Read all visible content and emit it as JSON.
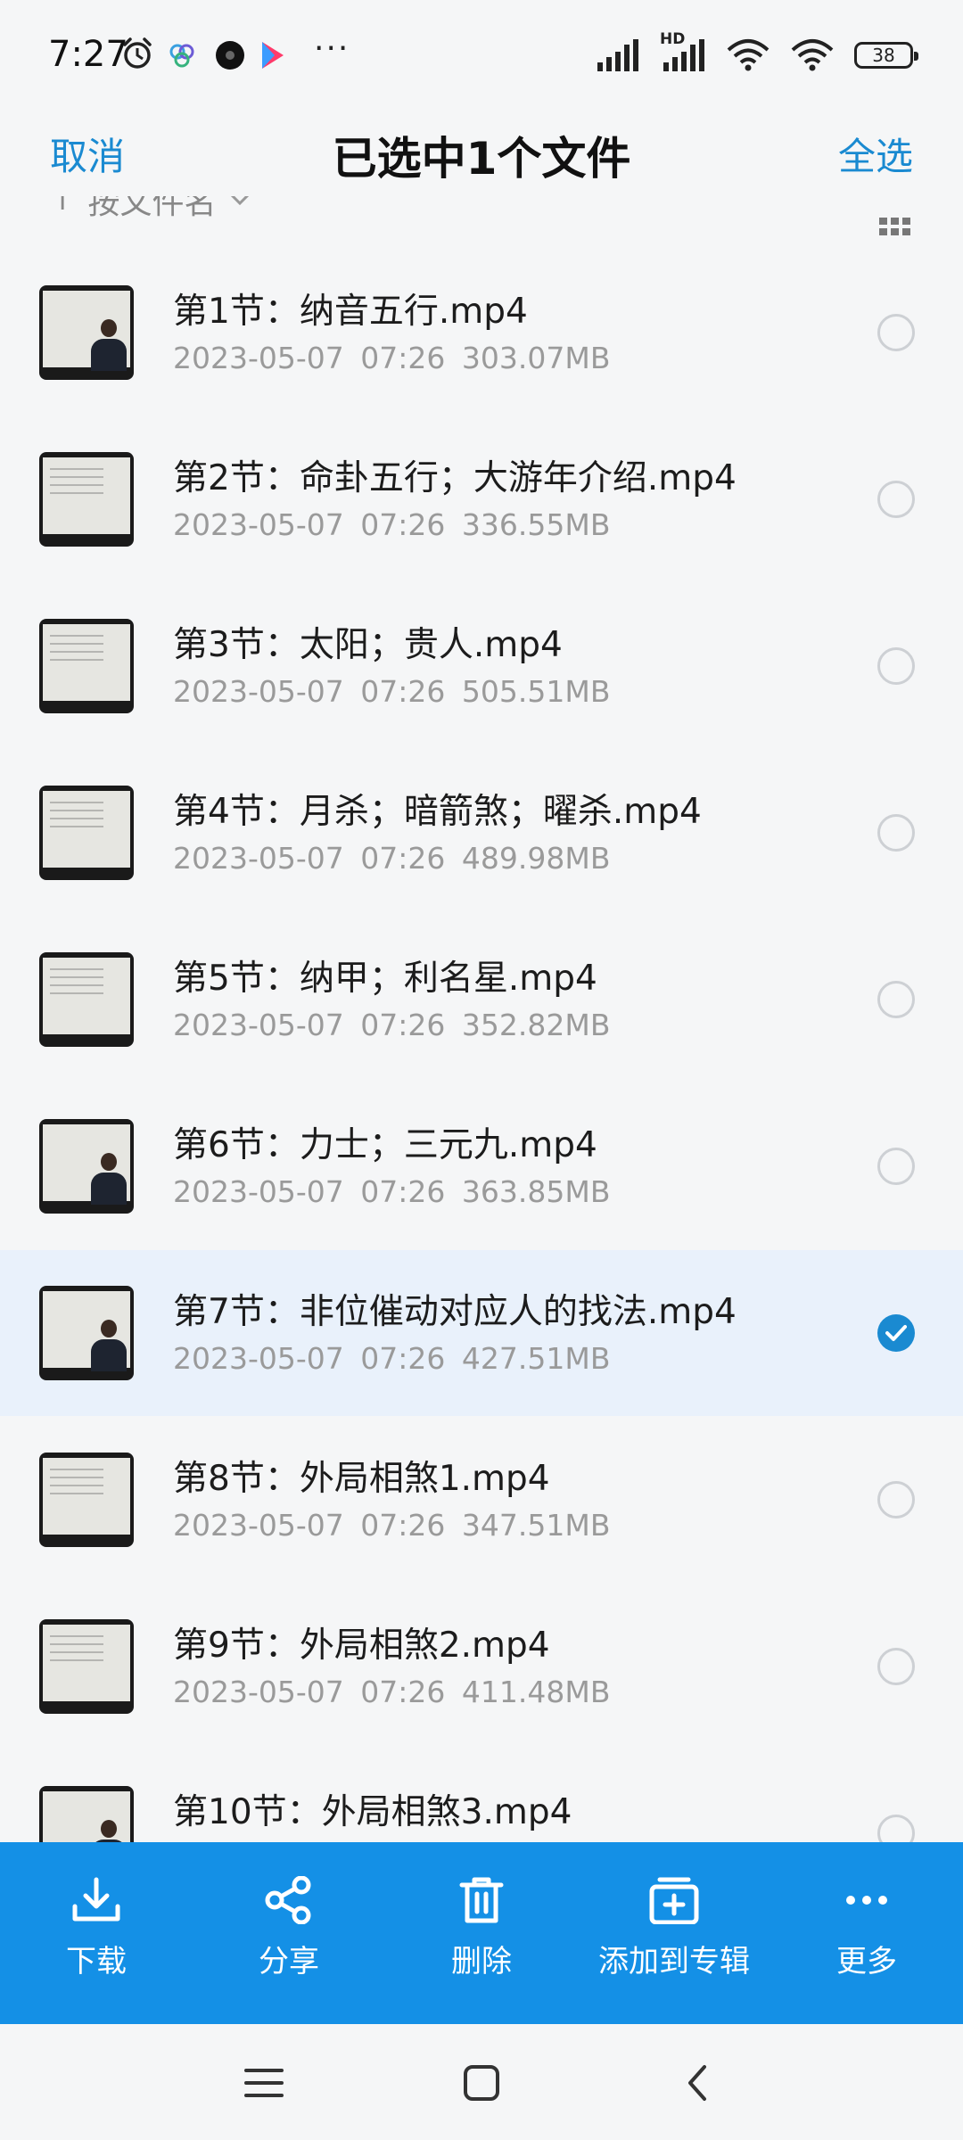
{
  "status_bar": {
    "time": "7:27",
    "more_dots": "···",
    "battery": "38",
    "hd_label": "HD"
  },
  "header": {
    "cancel": "取消",
    "title": "已选中1个文件",
    "select_all": "全选"
  },
  "sort": {
    "label": "按文件名"
  },
  "files": [
    {
      "name": "第1节：纳音五行.mp4",
      "date": "2023-05-07",
      "time": "07:26",
      "size": "303.07MB",
      "selected": false
    },
    {
      "name": "第2节：命卦五行；大游年介绍.mp4",
      "date": "2023-05-07",
      "time": "07:26",
      "size": "336.55MB",
      "selected": false
    },
    {
      "name": "第3节：太阳；贵人.mp4",
      "date": "2023-05-07",
      "time": "07:26",
      "size": "505.51MB",
      "selected": false
    },
    {
      "name": "第4节：月杀；暗箭煞；曜杀.mp4",
      "date": "2023-05-07",
      "time": "07:26",
      "size": "489.98MB",
      "selected": false
    },
    {
      "name": "第5节：纳甲；利名星.mp4",
      "date": "2023-05-07",
      "time": "07:26",
      "size": "352.82MB",
      "selected": false
    },
    {
      "name": "第6节：力士；三元九.mp4",
      "date": "2023-05-07",
      "time": "07:26",
      "size": "363.85MB",
      "selected": false
    },
    {
      "name": "第7节：非位催动对应人的找法.mp4",
      "date": "2023-05-07",
      "time": "07:26",
      "size": "427.51MB",
      "selected": true
    },
    {
      "name": "第8节：外局相煞1.mp4",
      "date": "2023-05-07",
      "time": "07:26",
      "size": "347.51MB",
      "selected": false
    },
    {
      "name": "第9节：外局相煞2.mp4",
      "date": "2023-05-07",
      "time": "07:26",
      "size": "411.48MB",
      "selected": false
    },
    {
      "name": "第10节：外局相煞3.mp4",
      "date": "",
      "time": "",
      "size": "",
      "selected": false
    }
  ],
  "actions": {
    "download": "下载",
    "share": "分享",
    "delete": "删除",
    "add_to_album": "添加到专辑",
    "more": "更多"
  },
  "colors": {
    "accent": "#1a8ad1",
    "action_bar": "#1490e6",
    "selected_row": "#e9f1fb"
  }
}
